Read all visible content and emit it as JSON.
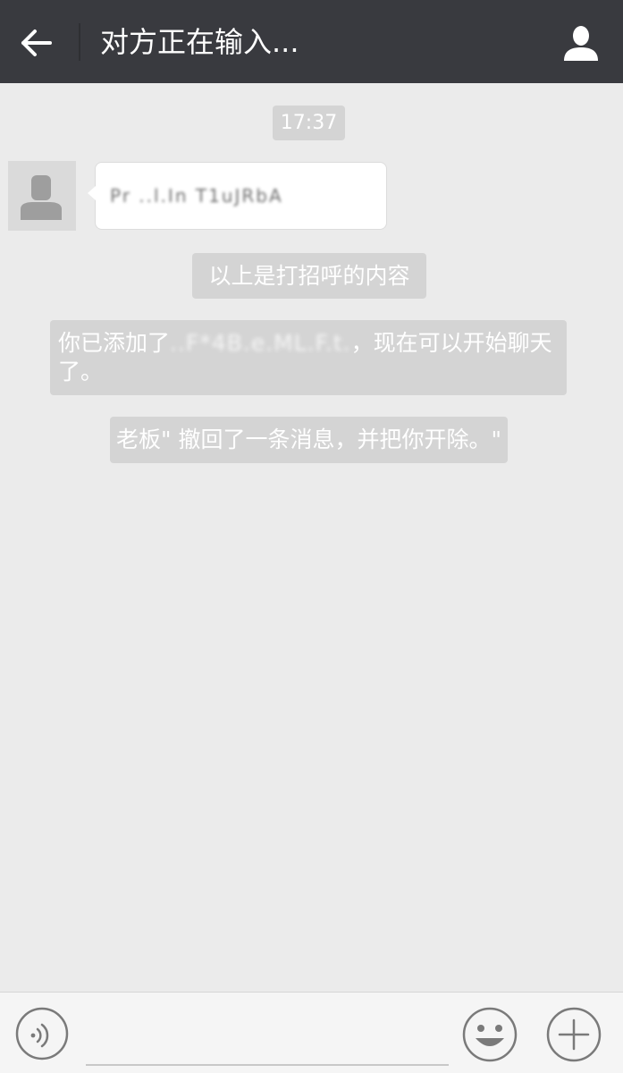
{
  "header": {
    "title": "对方正在输入..."
  },
  "chat": {
    "timestamp": "17:37",
    "message_text": "Pr ..l.In T1uJRbA",
    "system_messages": {
      "greeting_note": "以上是打招呼的内容",
      "added_prefix": "你已添加了",
      "added_name": "..F*4B.e.ML.F.t.",
      "added_suffix": "，现在可以开始聊天了。",
      "recall_note": "老板\" 撤回了一条消息，并把你开除。\""
    }
  },
  "input": {
    "placeholder": ""
  },
  "icons": {
    "back": "back-arrow-icon",
    "profile": "person-icon",
    "voice": "voice-icon",
    "emoji": "smiley-icon",
    "more": "plus-icon"
  },
  "colors": {
    "header_bg": "#393a3f",
    "chat_bg": "#ebebeb",
    "system_pill": "#d4d4d4",
    "bubble": "#ffffff"
  }
}
